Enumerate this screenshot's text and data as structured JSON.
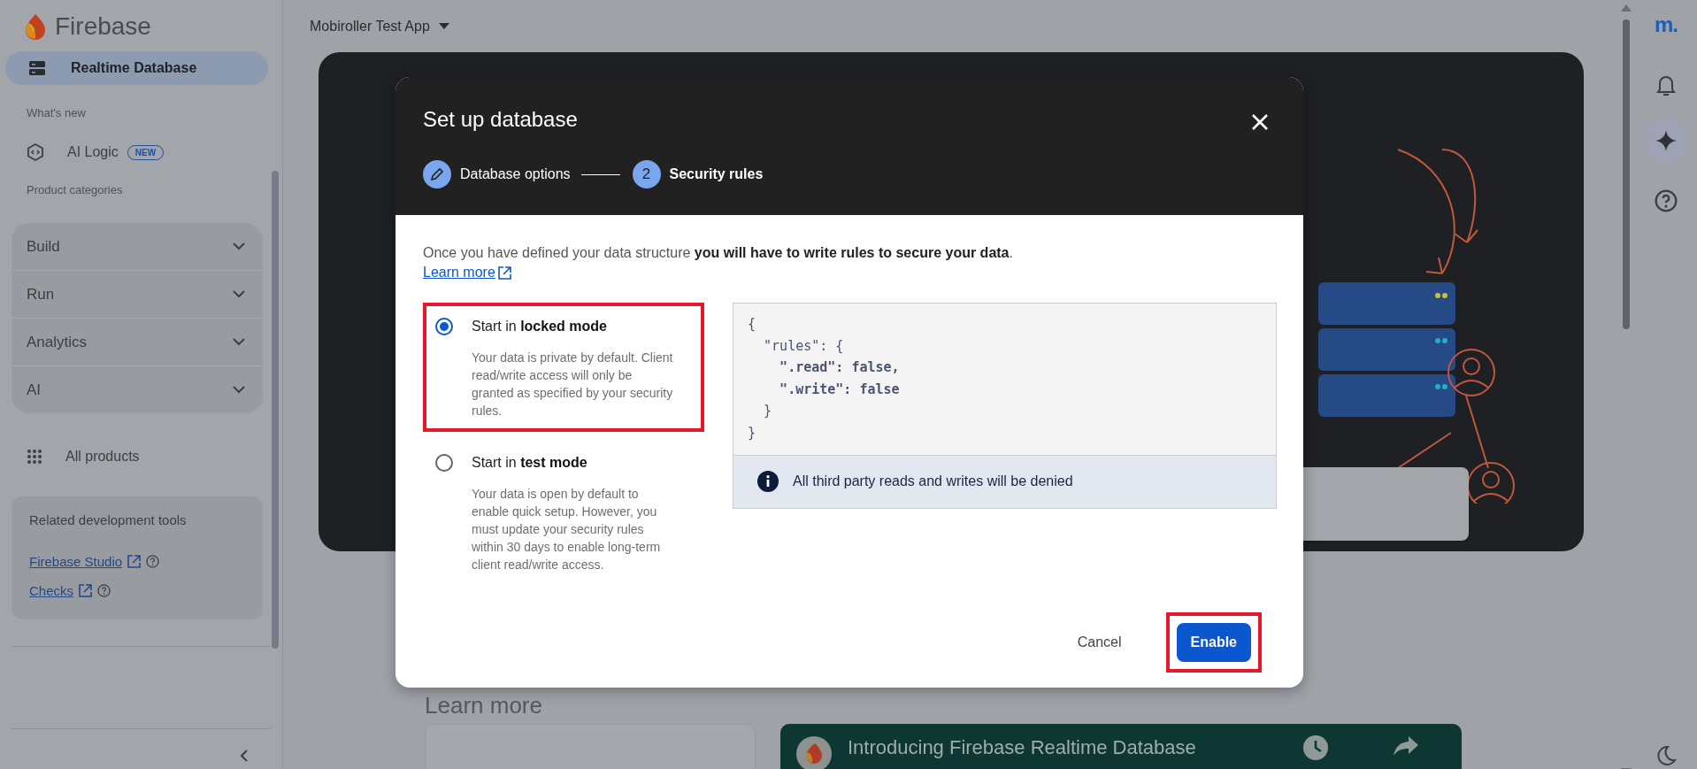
{
  "sidebar": {
    "brand": "Firebase",
    "pinned": {
      "label": "Realtime Database",
      "selected": true
    },
    "whats_new": {
      "heading": "What's new",
      "items": [
        {
          "label": "AI Logic",
          "badge": "NEW"
        }
      ]
    },
    "categories": {
      "heading": "Product categories",
      "items": [
        {
          "label": "Build",
          "expanded": false
        },
        {
          "label": "Run",
          "expanded": false
        },
        {
          "label": "Analytics",
          "expanded": false
        },
        {
          "label": "AI",
          "expanded": false
        }
      ]
    },
    "all_products": "All products",
    "related_tools": {
      "heading": "Related development tools",
      "links": [
        {
          "label": "Firebase Studio"
        },
        {
          "label": "Checks"
        }
      ]
    }
  },
  "topbar": {
    "project": "Mobiroller Test App"
  },
  "page": {
    "learn_more_heading": "Learn more",
    "video": {
      "title": "Introducing Firebase Realtime Database"
    }
  },
  "rail": {
    "account_logo": "m."
  },
  "dialog": {
    "title": "Set up database",
    "steps": [
      {
        "kind": "done",
        "label": "Database options",
        "selected": false
      },
      {
        "kind": "number",
        "number": "2",
        "label": "Security rules",
        "selected": true
      }
    ],
    "intro": "Once you have defined your data structure **you will have to write rules to secure your data**.",
    "learn_more": "Learn more",
    "options": [
      {
        "title": "Start in **locked mode**",
        "description": "Your data is private by default. Client read/write access will only be granted as specified by your security rules.",
        "selected": true,
        "highlighted": true
      },
      {
        "title": "Start in **test mode**",
        "description": "Your data is open by default to enable quick setup. However, you must update your security rules within 30 days to enable long-term client read/write access.",
        "selected": false,
        "highlighted": false
      }
    ],
    "rules_code": [
      {
        "text": "{",
        "bold": false
      },
      {
        "text": "  \"rules\": {",
        "bold": false
      },
      {
        "text": "    \".read\": false,",
        "bold": true
      },
      {
        "text": "    \".write\": false",
        "bold": true
      },
      {
        "text": "  }",
        "bold": false
      },
      {
        "text": "}",
        "bold": false
      }
    ],
    "notice": "All third party reads and writes will be denied",
    "buttons": [
      {
        "kind": "text",
        "label": "Cancel",
        "highlighted": false
      },
      {
        "kind": "primary",
        "label": "Enable",
        "highlighted": true
      }
    ]
  }
}
